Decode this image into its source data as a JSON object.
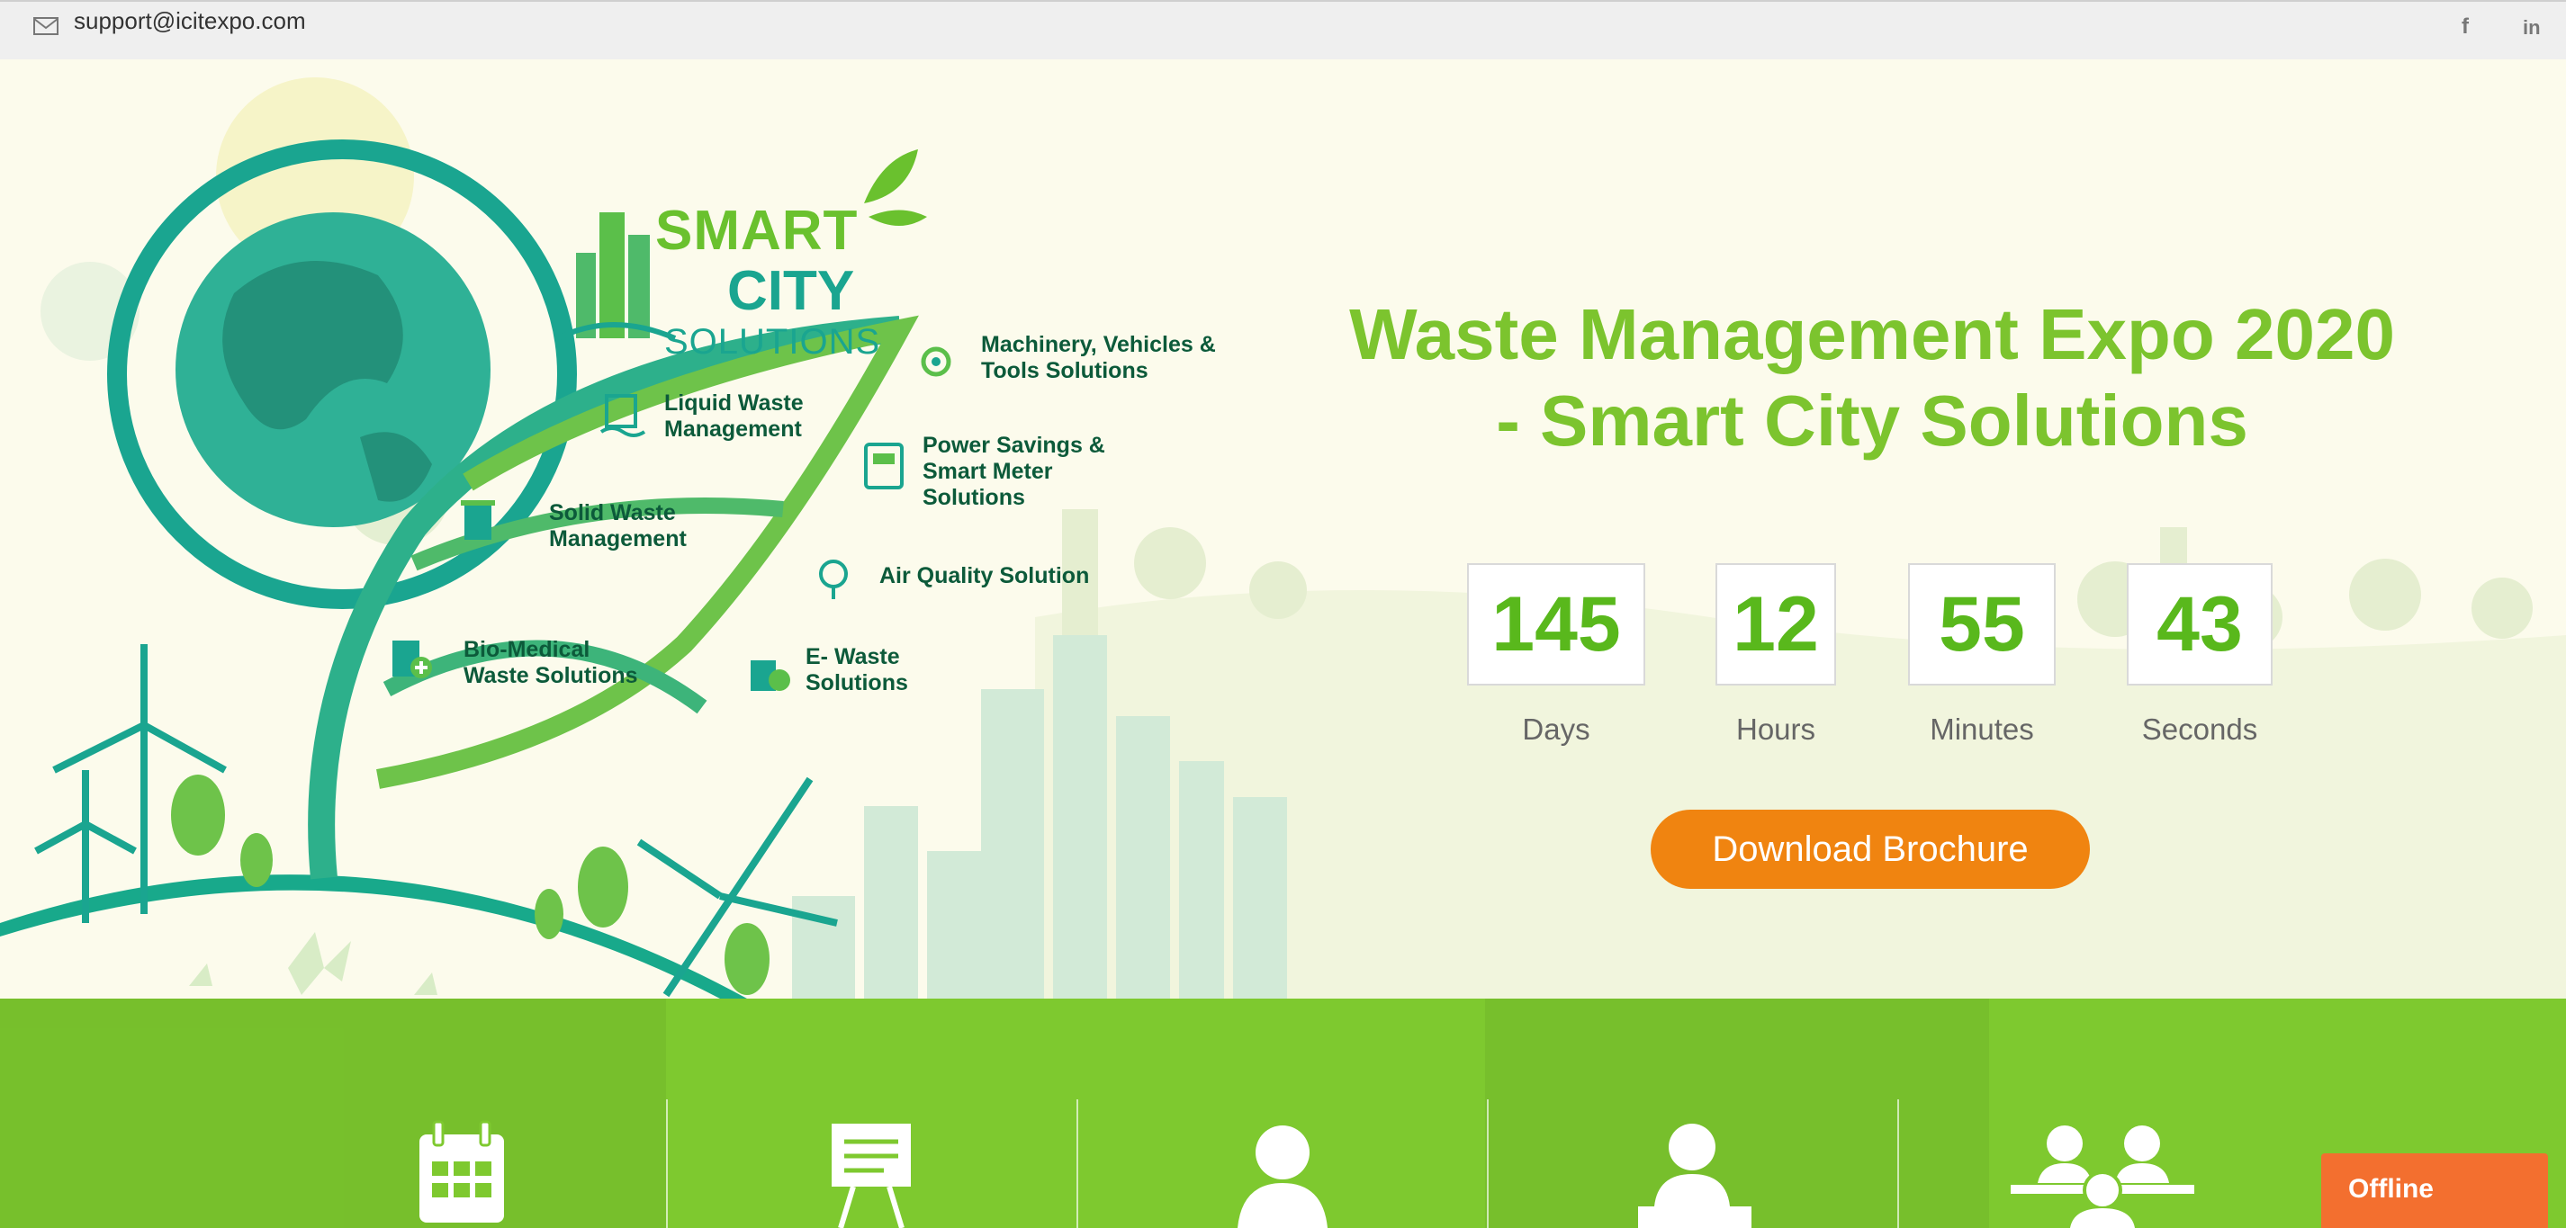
{
  "topbar": {
    "email": "support@icitexpo.com",
    "icons": [
      "mail-icon",
      "facebook-icon",
      "linkedin-icon"
    ],
    "facebook_glyph": "f",
    "linkedin_glyph": "in"
  },
  "logo": {
    "line1": "SMART",
    "line2": "CITY",
    "line3": "SOLUTIONS"
  },
  "services": [
    {
      "label_1": "Machinery, Vehicles &",
      "label_2": "Tools Solutions"
    },
    {
      "label_1": "Liquid Waste",
      "label_2": "Management"
    },
    {
      "label_1": "Power Savings &",
      "label_2": "Smart Meter",
      "label_3": "Solutions"
    },
    {
      "label_1": "Solid Waste",
      "label_2": "Management"
    },
    {
      "label_1": "Air Quality Solution"
    },
    {
      "label_1": "Bio-Medical",
      "label_2": "Waste Solutions"
    },
    {
      "label_1": "E- Waste",
      "label_2": "Solutions"
    }
  ],
  "hero": {
    "title_line1": "Waste Management Expo 2020",
    "title_line2": "- Smart City Solutions",
    "countdown": {
      "days": "145",
      "days_label": "Days",
      "hours": "12",
      "hours_label": "Hours",
      "minutes": "55",
      "minutes_label": "Minutes",
      "seconds": "43",
      "seconds_label": "Seconds"
    },
    "brochure_button": "Download Brochure"
  },
  "features": {
    "icons": [
      "calendar-icon",
      "presentation-board-icon",
      "visitor-icon",
      "speaker-podium-icon",
      "meeting-group-icon"
    ]
  },
  "chat": {
    "status": "Offline"
  },
  "colors": {
    "title_green": "#7cc42e",
    "count_green": "#59b81c",
    "band_green": "#7ec92f",
    "button_orange": "#f08410",
    "offline_orange": "#f36f2f",
    "teal": "#1aa590"
  }
}
